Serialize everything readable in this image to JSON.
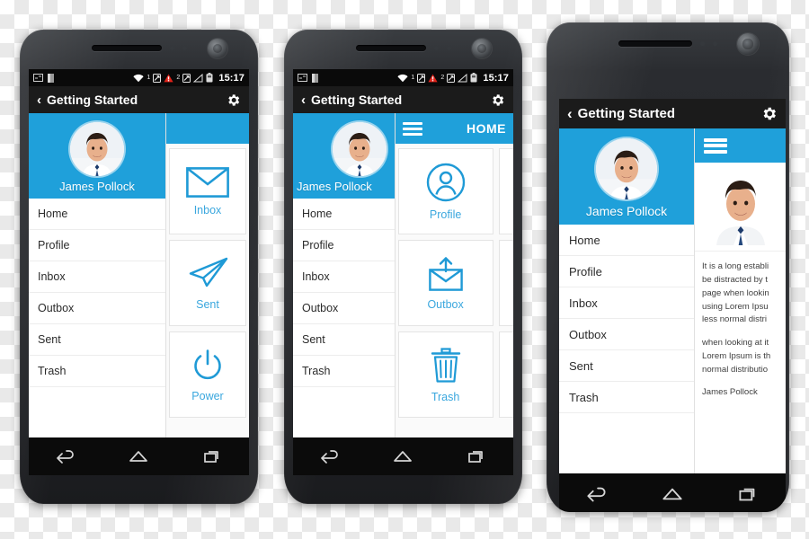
{
  "meta": {
    "accent_blue": "#1fa0da",
    "tile_label_blue": "#3aa7de",
    "actionbar_bg": "#1b1b1b",
    "statusbar_bg": "#0a0a0a"
  },
  "statusbar": {
    "clock": "15:17",
    "left_icons": [
      "screenshot-icon",
      "sim-card-icon"
    ],
    "right_icons": [
      "wifi-icon",
      "sim1-signal-icon",
      "alert-icon",
      "sim2-signal-icon",
      "signal-icon",
      "battery-icon"
    ],
    "sim1_label": "1",
    "sim2_label": "2"
  },
  "actionbar": {
    "back_glyph": "‹",
    "title": "Getting Started",
    "settings_icon": "gear-icon"
  },
  "drawer": {
    "user_name": "James Pollock",
    "avatar": "user-photo",
    "items": [
      {
        "label": "Home"
      },
      {
        "label": "Profile"
      },
      {
        "label": "Inbox"
      },
      {
        "label": "Outbox"
      },
      {
        "label": "Sent"
      },
      {
        "label": "Trash"
      }
    ]
  },
  "navbar": {
    "items": [
      {
        "name": "back-nav-button",
        "icon": "back-arrow-icon"
      },
      {
        "name": "home-nav-button",
        "icon": "home-icon"
      },
      {
        "name": "recents-nav-button",
        "icon": "recents-icon"
      }
    ]
  },
  "phone1": {
    "tiles": [
      {
        "label": "Inbox",
        "icon": "envelope-icon"
      },
      {
        "label": "Sent",
        "icon": "paper-plane-icon"
      },
      {
        "label": "Power",
        "icon": "power-icon"
      }
    ]
  },
  "phone2": {
    "content_title": "HOME",
    "menu_icon": "hamburger-icon",
    "tiles": [
      {
        "label": "Profile",
        "icon": "user-circle-icon"
      },
      {
        "label": "Outbox",
        "icon": "outbox-envelope-icon"
      },
      {
        "label": "Trash",
        "icon": "trash-icon"
      }
    ]
  },
  "phone3": {
    "menu_icon": "hamburger-icon",
    "hero_image": "user-photo",
    "paragraphs": [
      "It is a long establi\nbe distracted by t\npage when lookin\nusing Lorem Ipsu\nless normal distri",
      "when looking at it\nLorem Ipsum is th\nnormal distributio"
    ],
    "signature": "James Pollock"
  }
}
